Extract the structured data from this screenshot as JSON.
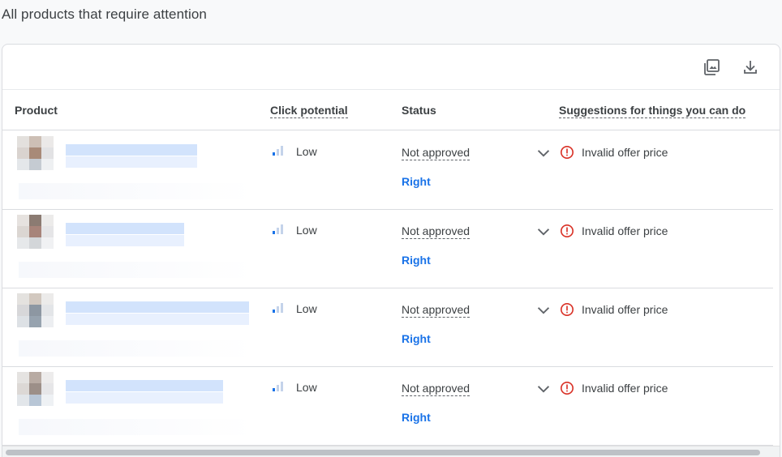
{
  "page": {
    "title": "All products that require attention"
  },
  "toolbar": {
    "images_icon": "image-gallery-icon",
    "download_icon": "download-icon"
  },
  "table": {
    "columns": {
      "product": "Product",
      "click_potential": "Click potential",
      "status": "Status",
      "suggestions": "Suggestions for things you can do"
    },
    "rows": [
      {
        "product_name": "",
        "click_potential": "Low",
        "status": "Not approved",
        "action": "Right",
        "issue": "Invalid offer price"
      },
      {
        "product_name": "",
        "click_potential": "Low",
        "status": "Not approved",
        "action": "Right",
        "issue": "Invalid offer price"
      },
      {
        "product_name": "",
        "click_potential": "Low",
        "status": "Not approved",
        "action": "Right",
        "issue": "Invalid offer price"
      },
      {
        "product_name": "",
        "click_potential": "Low",
        "status": "Not approved",
        "action": "Right",
        "issue": "Invalid offer price"
      }
    ]
  },
  "colors": {
    "link": "#1a73e8",
    "error": "#d93025",
    "signal_active": "#1a73e8",
    "signal_inactive": "#c4d3ea"
  }
}
